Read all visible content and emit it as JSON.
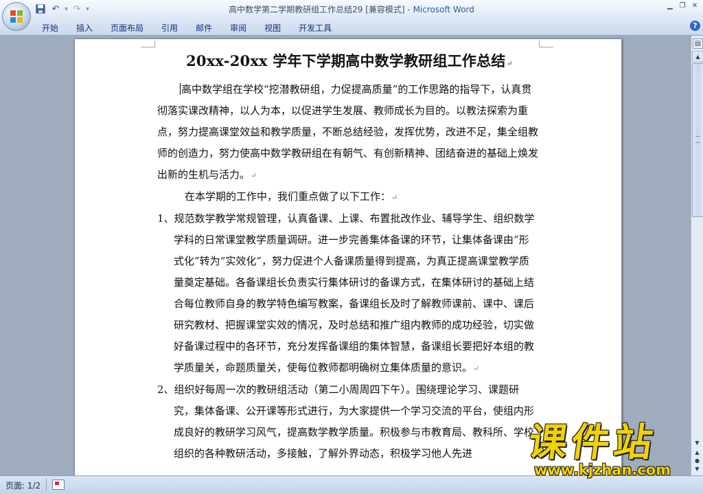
{
  "window": {
    "title_doc": "高中数学第二学期教研组工作总结29 [兼容模式]",
    "title_sep": " - ",
    "title_app": "Microsoft Word"
  },
  "quick_access": {
    "icons": [
      "save-icon",
      "undo-icon",
      "redo-icon",
      "customize-icon"
    ],
    "undo_glyph": "↶",
    "redo_glyph": "↷",
    "dropdown_glyph": "▾"
  },
  "ribbon": {
    "tabs": [
      "开始",
      "插入",
      "页面布局",
      "引用",
      "邮件",
      "审阅",
      "视图",
      "开发工具"
    ],
    "help_glyph": "?"
  },
  "document": {
    "title": "20xx-20xx 学年下学期高中数学教研组工作总结",
    "intro": "高中数学组在学校“挖潜教研组，力促提高质量”的工作思路的指导下，认真贯彻落实课改精神，以人为本，以促进学生发展、教师成长为目的。以教法探索为重点，努力提高课堂效益和教学质量，不断总结经验，发挥优势，改进不足，集全组教师的创造力，努力使高中数学教研组在有朝气、有创新精神、团结奋进的基础上焕发出新的生机与活力。",
    "lead": "在本学期的工作中，我们重点做了以下工作：",
    "items": [
      "1、规范数学教学常规管理，认真备课、上课、布置批改作业、辅导学生、组织数学学科的日常课堂教学质量调研。进一步完善集体备课的环节，让集体备课由“形式化”转为“实效化”，努力促进个人备课质量得到提高，为真正提高课堂教学质量奠定基础。各备课组长负责实行集体研讨的备课方式，在集体研讨的基础上结合每位教师自身的教学特色编写教案，备课组长及时了解教师课前、课中、课后研究教材、把握课堂实效的情况，及时总结和推广组内教师的成功经验，切实做好备课过程中的各环节，充分发挥备课组的集体智慧，备课组长要把好本组的教学质量关，命题质量关，使每位教师都明确树立集体质量的意识。",
      "2、组织好每周一次的教研组活动（第二小周周四下午）。围绕理论学习、课题研究，集体备课、公开课等形式进行，为大家提供一个学习交流的平台，使组内形成良好的教研学习风气，提高数学教学质量。积极参与市教育局、教科所、学校组织的各种教研活动，多接触，了解外界动态，积极学习他人先进"
    ],
    "para_mark": "↵"
  },
  "statusbar": {
    "page_indicator": "页面: 1/2"
  },
  "watermark": {
    "brand": "课件站",
    "url": "www.kjzhan.com"
  },
  "colors": {
    "app_accent": "#2f5aa8",
    "ribbon_tab_text": "#15317a",
    "watermark_yellow": "#f2d200"
  }
}
